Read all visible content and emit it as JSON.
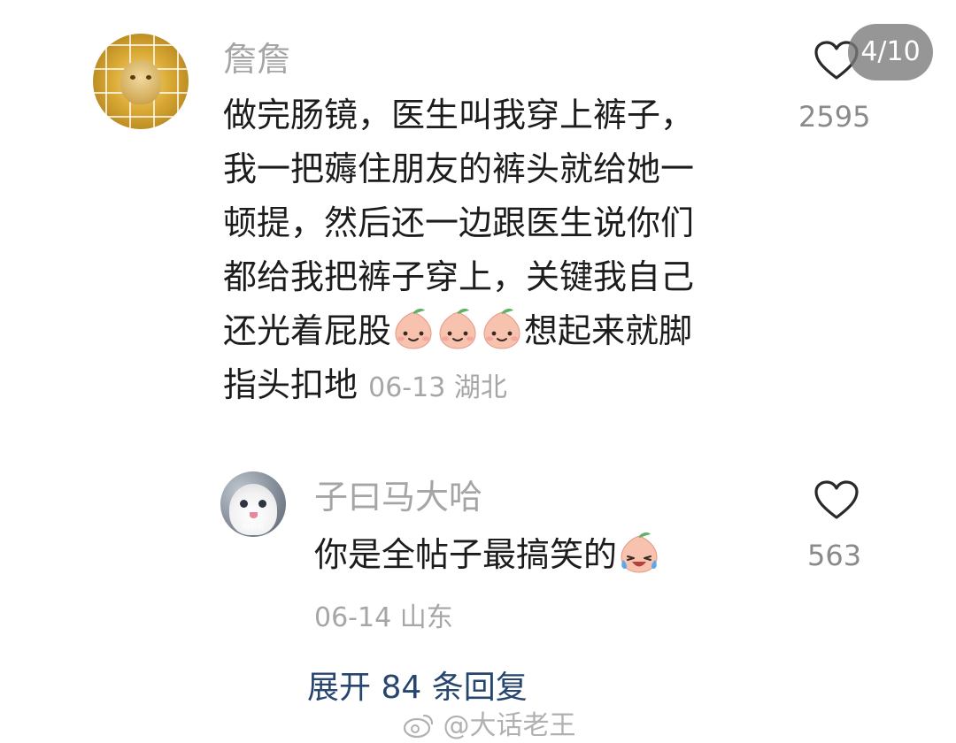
{
  "page_indicator": "4/10",
  "comment": {
    "username": "詹詹",
    "text_lines": [
      "做完肠镜，医生叫我穿上裤子，",
      "我一把薅住朋友的裤头就给她一",
      "顿提，然后还一边跟医生说你们",
      "都给我把裤子穿上，关键我自己",
      "还光着屁股",
      "想起来就脚",
      "指头扣地"
    ],
    "emoji_count": 3,
    "emoji_name": "smiling-peach-emoji",
    "meta": "06-13 湖北",
    "like_count": "2595"
  },
  "reply": {
    "username": "子曰马大哈",
    "avatar_tag": "哈哈哈",
    "text": "你是全帖子最搞笑的",
    "emoji_name": "crying-laughing-peach-emoji",
    "meta": "06-14 山东",
    "like_count": "563"
  },
  "expand_replies": "展开 84 条回复",
  "watermark": "@大话老王",
  "colors": {
    "username": "#a5a5a5",
    "meta": "#a6a6a6",
    "expand_link": "#27466f",
    "badge_bg": "#787878"
  }
}
